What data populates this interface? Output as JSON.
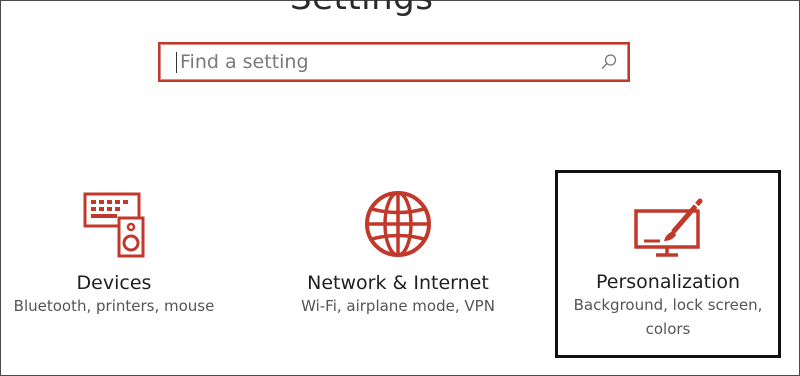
{
  "header": {
    "title_fragment": "Settings"
  },
  "search": {
    "placeholder": "Find a setting",
    "value": ""
  },
  "tiles": [
    {
      "title": "Devices",
      "description": "Bluetooth, printers, mouse",
      "icon": "devices-icon"
    },
    {
      "title": "Network & Internet",
      "description": "Wi-Fi, airplane mode, VPN",
      "icon": "globe-icon"
    },
    {
      "title": "Personalization",
      "description_line1": "Background, lock screen,",
      "description_line2": "colors",
      "icon": "personalization-icon"
    }
  ],
  "colors": {
    "accent": "#c0392b",
    "selection_border": "#111111",
    "text": "#1f1f1f",
    "subtext": "#555555"
  }
}
